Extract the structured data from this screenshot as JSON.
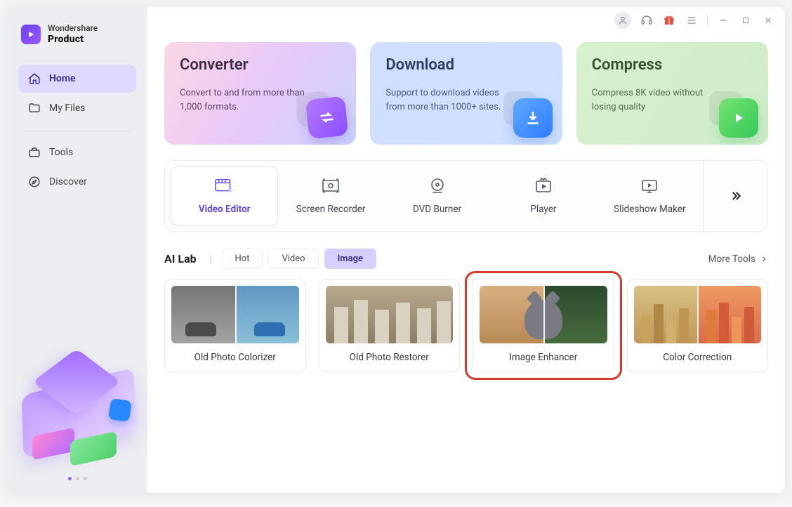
{
  "brand": {
    "line1": "Wondershare",
    "line2": "Product"
  },
  "sidebar": {
    "items": [
      {
        "label": "Home",
        "active": true
      },
      {
        "label": "My Files",
        "active": false
      },
      {
        "label": "Tools",
        "active": false
      },
      {
        "label": "Discover",
        "active": false
      }
    ]
  },
  "cards": {
    "converter": {
      "title": "Converter",
      "desc": "Convert to and from more than 1,000 formats."
    },
    "download": {
      "title": "Download",
      "desc": "Support to download videos from more than 1000+ sites."
    },
    "compress": {
      "title": "Compress",
      "desc": "Compress 8K video without losing quality"
    }
  },
  "tools": [
    {
      "label": "Video Editor",
      "selected": true
    },
    {
      "label": "Screen Recorder",
      "selected": false
    },
    {
      "label": "DVD Burner",
      "selected": false
    },
    {
      "label": "Player",
      "selected": false
    },
    {
      "label": "Slideshow Maker",
      "selected": false
    }
  ],
  "ailab": {
    "title": "AI Lab",
    "tabs": [
      {
        "label": "Hot",
        "active": false
      },
      {
        "label": "Video",
        "active": false
      },
      {
        "label": "Image",
        "active": true
      }
    ],
    "more": "More Tools",
    "cards": [
      {
        "label": "Old Photo Colorizer",
        "highlight": false
      },
      {
        "label": "Old Photo Restorer",
        "highlight": false
      },
      {
        "label": "Image Enhancer",
        "highlight": true
      },
      {
        "label": "Color Correction",
        "highlight": false
      }
    ]
  }
}
